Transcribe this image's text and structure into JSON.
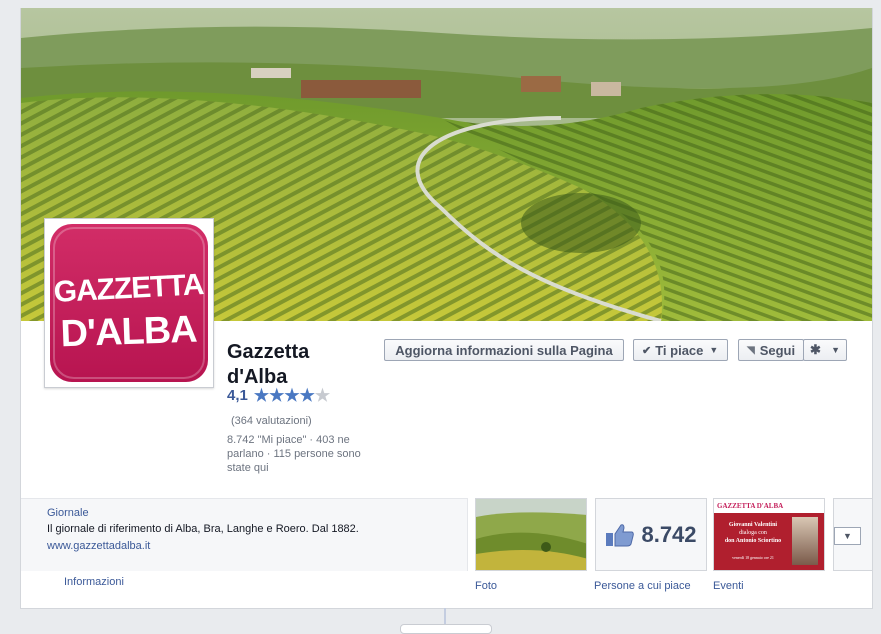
{
  "page": {
    "name": "Gazzetta d'Alba",
    "logo_line1": "GAZZETTA",
    "logo_line2": "D'ALBA",
    "rating_value": "4,1",
    "rating_stars": 4,
    "rating_count": "(364 valutazioni)",
    "stats": "8.742 \"Mi piace\" · 403 ne parlano · 115 persone sono state qui"
  },
  "actions": {
    "update_info": "Aggiorna informazioni sulla Pagina",
    "like": "Ti piace",
    "follow": "Segui"
  },
  "about": {
    "category": "Giornale",
    "description": "Il giornale di riferimento di Alba, Bra, Langhe e Roero. Dal 1882.",
    "website": "www.gazzettadalba.it",
    "info_link": "Informazioni"
  },
  "apps": {
    "photos_label": "Foto",
    "likes_count": "8.742",
    "likes_label": "Persone a cui piace",
    "events_label": "Eventi",
    "events_thumb": {
      "brand": "GAZZETTA D'ALBA",
      "line1": "Giovanni Valentini",
      "line2": "dialoga con",
      "line3": "don Antonio Sciortino",
      "date": "venerdì 18 gennaio ore 21"
    }
  },
  "colors": {
    "brand_blue": "#3b5998",
    "logo_magenta": "#c41e5a"
  }
}
